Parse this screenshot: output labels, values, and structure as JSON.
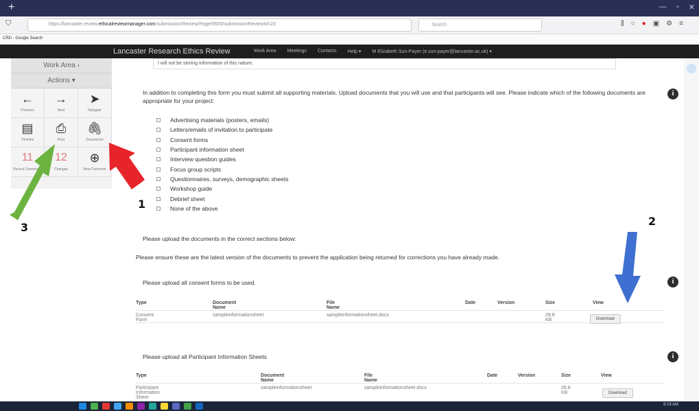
{
  "browser": {
    "url_prefix": "https://lancaster.review.",
    "url_domain": "ethicalreviewmanager.com",
    "url_suffix": "/submission/Review/Page/9603/submissionReviewId=23",
    "search_placeholder": "Search",
    "bookmark": "CRD - Google Search"
  },
  "app": {
    "brand": "Lancaster Research Ethics Review",
    "menu": [
      "Work Area",
      "Meetings",
      "Contacts",
      "Help ▾",
      "M Elizabeth Sun-Payer (e.sun-payer@lancaster.ac.uk) ▾"
    ]
  },
  "leftpanel": {
    "work_area": "Work Area ›",
    "actions": "Actions ▾",
    "tiles": [
      {
        "icon": "arrow-left-circle-icon",
        "glyph": "←",
        "label": "Previous"
      },
      {
        "icon": "arrow-right-circle-icon",
        "glyph": "→",
        "label": "Next"
      },
      {
        "icon": "navigate-arrow-icon",
        "glyph": "➤",
        "label": "Navigate"
      },
      {
        "icon": "timeline-icon",
        "glyph": "▤",
        "label": "Timeline"
      },
      {
        "icon": "printer-icon",
        "glyph": "⎙",
        "label": "Print"
      },
      {
        "icon": "paperclip-icon",
        "glyph": "🖇",
        "label": "Documents"
      },
      {
        "icon": "",
        "number": "11",
        "label": "Recent Comments"
      },
      {
        "icon": "",
        "number": "12",
        "label": "Changes"
      },
      {
        "icon": "plus-circle-icon",
        "glyph": "⊕",
        "label": "New Comment"
      }
    ]
  },
  "main": {
    "top_field": "I will not be storing information of this nature.",
    "intro": "In addition to completing this form you must submit all supporting materials. Upload documents that you will use and that participants will see. Please indicate which of the following documents are appropriate for your project:",
    "checklist": [
      "Advertising materials (posters, emails)",
      "Letters/emails of invitation to participate",
      "Consent forms",
      "Participant information sheet",
      "Interview question guides",
      "Focus group scripts",
      "Questionnaires, surveys, demographic sheets",
      "Workshop guide",
      "Debrief sheet",
      "None of the above"
    ],
    "upload_note": "Please upload the documents in the correct sections below:",
    "latest_note": "Please ensure these are the latest version of the documents to prevent the application being returned for corrections you have already made.",
    "consent_heading": "Please upload all consent forms to be used.",
    "pis_heading": "Please upload all Participant Information Sheets",
    "columns": [
      "Type",
      "Document Name",
      "File Name",
      "Date",
      "Version",
      "Size",
      "View"
    ],
    "consent_row": {
      "type": "Consent Form",
      "doc": "sampleinformationsheet",
      "file": "sampleinformationsheet.docx",
      "size": "28.8 KB",
      "view": "Download"
    },
    "pis_row": {
      "type": "Participant Information Sheet",
      "doc": "sampleinformationsheet",
      "file": "sampleinformationsheet.docx",
      "size": "28.8 KB",
      "view": "Download"
    }
  },
  "annotations": {
    "n1": "1",
    "n2": "2",
    "n3": "3",
    "colors": {
      "red": "#e8242b",
      "green": "#6cb33f",
      "blue": "#3f6fd1"
    }
  },
  "taskbar": {
    "time": "9:19 AM"
  }
}
